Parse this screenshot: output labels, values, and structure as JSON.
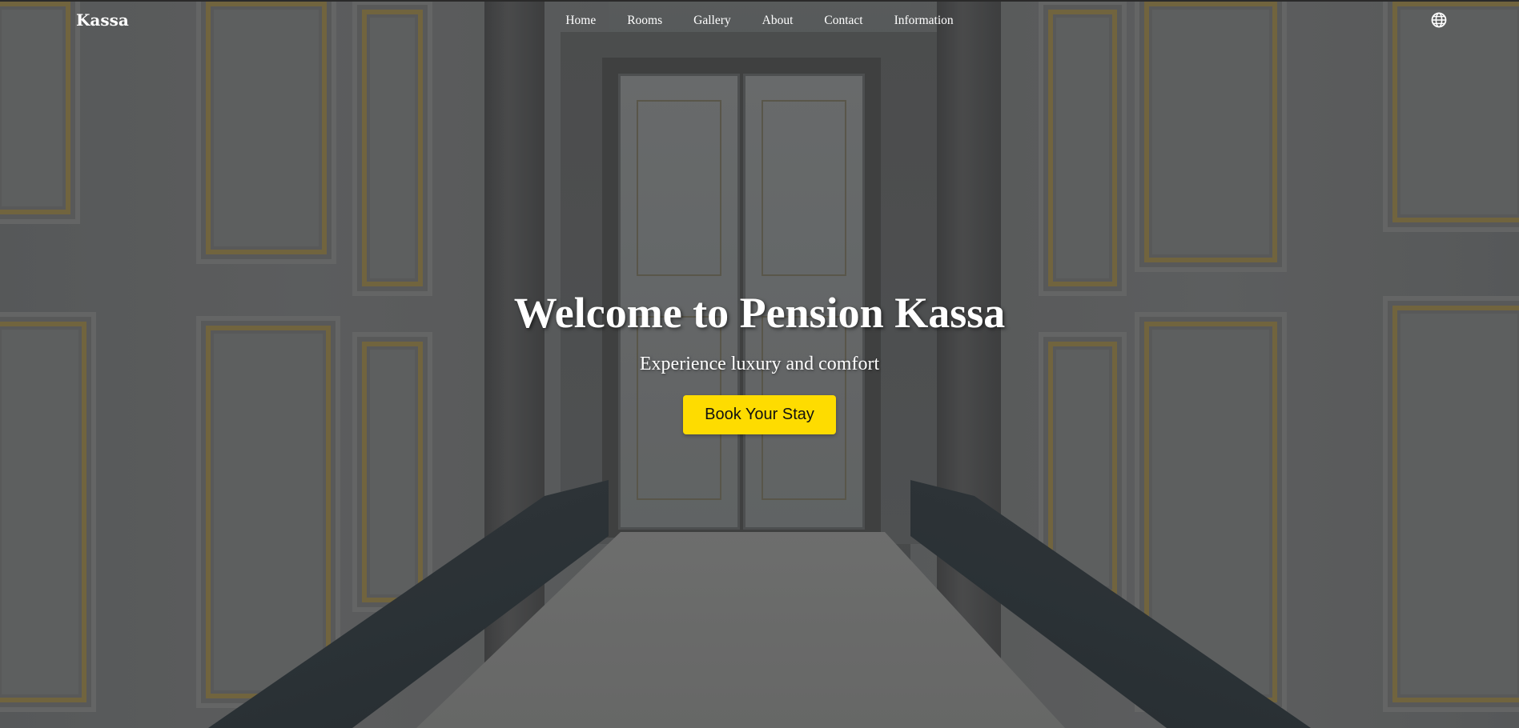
{
  "brand": {
    "name": "Kassa"
  },
  "nav": {
    "items": [
      {
        "label": "Home"
      },
      {
        "label": "Rooms"
      },
      {
        "label": "Gallery"
      },
      {
        "label": "About"
      },
      {
        "label": "Contact"
      },
      {
        "label": "Information"
      }
    ],
    "language_icon": "globe-icon"
  },
  "hero": {
    "title": "Welcome to Pension Kassa",
    "subtitle": "Experience luxury and comfort",
    "cta_label": "Book Your Stay",
    "background": "hallway-with-white-paneled-walls-and-double-doors"
  },
  "colors": {
    "accent": "#fedc00",
    "text": "#ffffff"
  }
}
